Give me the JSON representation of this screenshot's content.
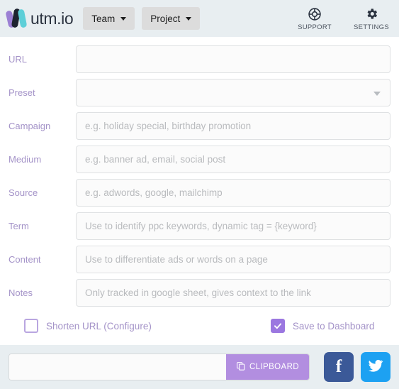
{
  "header": {
    "logo_text": "utm.io",
    "logo_icon": "utm-io-logo-icon",
    "team_button": "Team",
    "project_button": "Project",
    "support_label": "SUPPORT",
    "support_icon": "lifebuoy-icon",
    "settings_label": "SETTINGS",
    "settings_icon": "gear-icon",
    "colors": {
      "background": "#e8eef1",
      "button_bg": "#dcdcdc",
      "logo_purple": "#9b7fd4",
      "logo_black": "#1d2330",
      "logo_teal": "#5ecfd8"
    }
  },
  "form": {
    "fields": [
      {
        "label": "URL",
        "placeholder": "",
        "value": "",
        "type": "text"
      },
      {
        "label": "Preset",
        "placeholder": "",
        "value": "",
        "type": "select"
      },
      {
        "label": "Campaign",
        "placeholder": "e.g. holiday special, birthday promotion",
        "value": "",
        "type": "text"
      },
      {
        "label": "Medium",
        "placeholder": "e.g. banner ad, email, social post",
        "value": "",
        "type": "text"
      },
      {
        "label": "Source",
        "placeholder": "e.g. adwords, google, mailchimp",
        "value": "",
        "type": "text"
      },
      {
        "label": "Term",
        "placeholder": "Use to identify ppc keywords, dynamic tag = {keyword}",
        "value": "",
        "type": "text"
      },
      {
        "label": "Content",
        "placeholder": "Use to differentiate ads or words on a page",
        "value": "",
        "type": "text"
      },
      {
        "label": "Notes",
        "placeholder": "Only tracked in google sheet, gives context to the link",
        "value": "",
        "type": "text"
      }
    ],
    "label_color": "#a493c8"
  },
  "options": {
    "shorten_url_label": "Shorten URL (Configure)",
    "shorten_url_checked": false,
    "save_dashboard_label": "Save to Dashboard",
    "save_dashboard_checked": true,
    "accent_color": "#9b77e0"
  },
  "bottom": {
    "result_placeholder": "",
    "result_value": "",
    "clipboard_label": "CLIPBOARD",
    "clipboard_icon": "copy-icon",
    "facebook_icon": "facebook-icon",
    "facebook_glyph": "f",
    "twitter_icon": "twitter-icon",
    "colors": {
      "background": "#e8eef1",
      "clipboard": "#b28ee0",
      "facebook": "#3b5998",
      "twitter": "#1da1f2"
    }
  }
}
